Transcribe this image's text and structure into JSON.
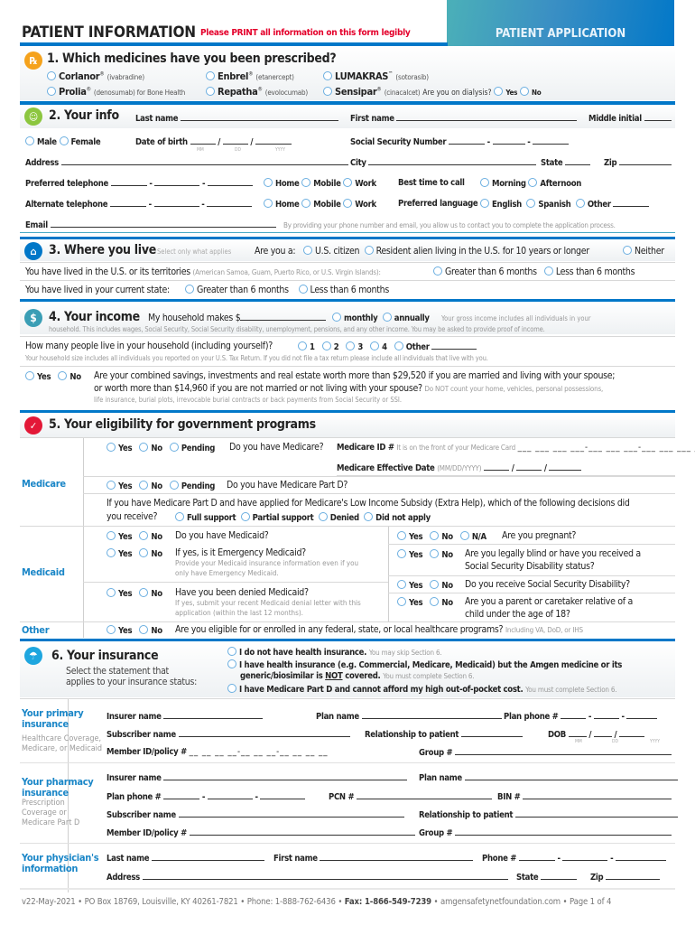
{
  "header": {
    "title": "PATIENT INFORMATION",
    "instruction": "Please PRINT all information on this form legibly",
    "banner": "PATIENT APPLICATION"
  },
  "colors": {
    "accent_blue": "#0077c8",
    "instruction_red": "#e4002b",
    "rx_orange": "#f5a21b",
    "info_green": "#8cc63f",
    "home_blue": "#0077c8",
    "income_teal": "#3a9eb5",
    "elig_red": "#e31837",
    "insurance_cyan": "#1ea6df"
  },
  "section1": {
    "number_title": "1. Which medicines have you been prescribed?",
    "icon": "rx-icon",
    "options": [
      {
        "name": "Corlanor",
        "mark": "®",
        "generic": "(ivabradine)"
      },
      {
        "name": "Enbrel",
        "mark": "®",
        "generic": "(etanercept)"
      },
      {
        "name": "LUMAKRAS",
        "mark": "™",
        "generic": "(sotorasib)"
      },
      {
        "name": "Prolia",
        "mark": "®",
        "generic": "(denosumab) for Bone Health"
      },
      {
        "name": "Repatha",
        "mark": "®",
        "generic": "(evolocumab)"
      },
      {
        "name": "Sensipar",
        "mark": "®",
        "generic": "(cinacalcet)"
      }
    ],
    "dialysis_question": "Are you on dialysis?",
    "yes": "Yes",
    "no": "No"
  },
  "section2": {
    "number_title": "2. Your info",
    "icon": "person-icon",
    "last_name": "Last name",
    "first_name": "First name",
    "middle_initial": "Middle initial",
    "male": "Male",
    "female": "Female",
    "dob": "Date of birth",
    "mm": "MM",
    "dd": "DD",
    "yyyy": "YYYY",
    "ssn": "Social Security Number",
    "address": "Address",
    "city": "City",
    "state": "State",
    "zip": "Zip",
    "preferred_tel": "Preferred telephone",
    "alternate_tel": "Alternate telephone",
    "home": "Home",
    "mobile": "Mobile",
    "work": "Work",
    "best_time": "Best time to call",
    "morning": "Morning",
    "afternoon": "Afternoon",
    "pref_lang": "Preferred language",
    "english": "English",
    "spanish": "Spanish",
    "other": "Other",
    "email": "Email",
    "consent": "By providing your phone number and email, you allow us to contact you to complete the application process."
  },
  "section3": {
    "number_title": "3. Where you live",
    "icon": "home-icon",
    "select_note": "Select only what applies",
    "are_you": "Are you a:",
    "citizen": "U.S. citizen",
    "resident": "Resident alien living in the U.S. for 10 years or longer",
    "neither": "Neither",
    "territories_q": "You have lived in the U.S. or its territories",
    "territories_note": "(American Samoa, Guam, Puerto Rico, or U.S. Virgin Islands):",
    "state_q": "You have lived in your current state:",
    "greater": "Greater than 6 months",
    "less": "Less than 6 months"
  },
  "section4": {
    "number_title": "4. Your income",
    "icon": "dollar-icon",
    "makes": "My household makes $",
    "monthly": "monthly",
    "annually": "annually",
    "gross_note1": "Your gross income includes all individuals in your",
    "gross_note2": "household. This includes wages, Social Security, Social Security disability, unemployment, pensions, and any other income. You may be asked to provide proof of income.",
    "household_q": "How many people live in your household (including yourself)?",
    "household_opts": [
      "1",
      "2",
      "3",
      "4",
      "Other"
    ],
    "household_note": "Your household size includes all individuals you reported on your U.S. Tax Return. If you did not file a tax return please include all individuals that live with you.",
    "yes": "Yes",
    "no": "No",
    "assets_q1": "Are your combined savings, investments and real estate worth more than $29,520 if you are married and living with your spouse;",
    "assets_q2": "or worth more than $14,960 if you are not married or not living with your spouse?",
    "assets_note1": "Do NOT count your home, vehicles, personal possessions,",
    "assets_note2": "life insurance, burial plots, irrevocable burial contracts or back payments from Social Security or SSI."
  },
  "section5": {
    "number_title": "5. Your eligibility for government programs",
    "icon": "check-heart-icon",
    "yes": "Yes",
    "no": "No",
    "pending": "Pending",
    "na": "N/A",
    "medicare_label": "Medicare",
    "medicaid_label": "Medicaid",
    "other_label": "Other",
    "have_medicare": "Do you have Medicare?",
    "medicare_id": "Medicare ID #",
    "medicare_id_note": "It is on the front of your Medicare Card",
    "effective_date": "Medicare Effective Date",
    "effective_fmt": "(MM/DD/YYYY)",
    "part_d_q": "Do you have Medicare Part D?",
    "lis_q1": "If you have Medicare Part D and have applied for Medicare's Low Income Subsidy (Extra Help), which of the following decisions did",
    "lis_q2": "you receive?",
    "lis_opts": [
      "Full support",
      "Partial support",
      "Denied",
      "Did not apply"
    ],
    "have_medicaid": "Do you have Medicaid?",
    "emergency_q": "If yes, is it Emergency Medicaid?",
    "emergency_note1": "Provide your Medicaid insurance information even if you",
    "emergency_note2": "only have Emergency Medicaid.",
    "denied_q": "Have you been denied Medicaid?",
    "denied_note1": "If yes, submit your recent Medicaid denial letter with this",
    "denied_note2": "application (within the last 12 months).",
    "pregnant_q": "Are you pregnant?",
    "blind_q1": "Are you legally blind or have you received a",
    "blind_q2": "Social Security Disability status?",
    "ssd_q": "Do you receive Social Security Disability?",
    "parent_q1": "Are you a parent or caretaker relative of a",
    "parent_q2": "child under the age of 18?",
    "other_q": "Are you eligible for or enrolled in any federal, state, or local healthcare programs?",
    "other_note": "Including VA, DoD, or IHS"
  },
  "section6": {
    "number_title": "6. Your insurance",
    "icon": "umbrella-icon",
    "sub1": "Select the statement that",
    "sub2": "applies to your insurance status:",
    "opt1": "I do not have health insurance.",
    "opt1_note": "You may skip Section 6.",
    "opt2a": "I have health insurance (e.g. Commercial, Medicare, Medicaid) but the Amgen medicine or its",
    "opt2b_pre": "generic/biosimilar is ",
    "opt2b_not": "NOT",
    "opt2b_post": " covered.",
    "opt2_note": "You must complete Section 6.",
    "opt3": "I have Medicare Part D and cannot afford my high out-of-pocket cost.",
    "opt3_note": "You must complete Section 6.",
    "primary_label1": "Your primary",
    "primary_label2": "insurance",
    "primary_sub1": "Healthcare Coverage,",
    "primary_sub2": "Medicare, or Medicaid",
    "pharmacy_label1": "Your pharmacy",
    "pharmacy_label2": "insurance",
    "pharmacy_sub1": "Prescription",
    "pharmacy_sub2": "Coverage or",
    "pharmacy_sub3": "Medicare Part D",
    "physician_label1": "Your physician's",
    "physician_label2": "information",
    "insurer_name": "Insurer name",
    "plan_name": "Plan name",
    "plan_phone": "Plan phone #",
    "subscriber_name": "Subscriber name",
    "relationship": "Relationship to patient",
    "dob": "DOB",
    "member_id": "Member ID/policy #",
    "group": "Group #",
    "pcn": "PCN #",
    "bin": "BIN #",
    "last_name": "Last name",
    "first_name": "First name",
    "phone": "Phone #",
    "address": "Address",
    "state": "State",
    "zip": "Zip",
    "mm": "MM",
    "dd": "DD",
    "yyyy": "YYYY"
  },
  "footer": {
    "version": "v22-May-2021",
    "address": "PO Box 18769, Louisville, KY 40261-7821",
    "phone": "Phone: 1-888-762-6436",
    "fax": "Fax: 1-866-549-7239",
    "website": "amgensafetynetfoundation.com",
    "page": "Page 1 of 4",
    "sep": "•"
  }
}
